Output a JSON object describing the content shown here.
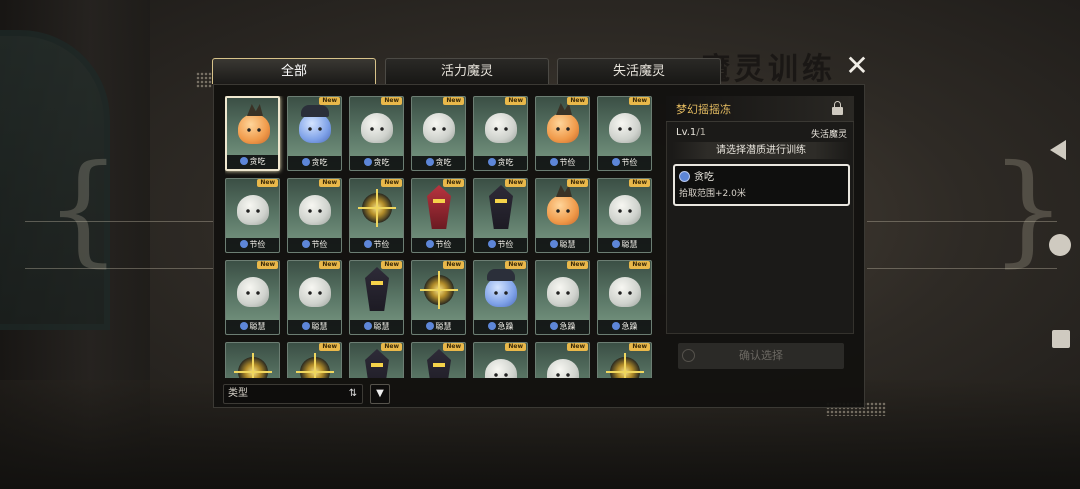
{
  "background": {
    "title": "魔灵训练"
  },
  "tabs": [
    {
      "label": "全部",
      "active": true
    },
    {
      "label": "活力魔灵",
      "active": false
    },
    {
      "label": "失活魔灵",
      "active": false
    }
  ],
  "grid": {
    "new_badge": "New",
    "cards": [
      {
        "trait": "贪吃",
        "creature": "orange",
        "new": false,
        "selected": true
      },
      {
        "trait": "贪吃",
        "creature": "blue",
        "new": true
      },
      {
        "trait": "贪吃",
        "creature": "white",
        "new": true
      },
      {
        "trait": "贪吃",
        "creature": "white",
        "new": true
      },
      {
        "trait": "贪吃",
        "creature": "white",
        "new": true
      },
      {
        "trait": "节俭",
        "creature": "orange",
        "new": true
      },
      {
        "trait": "节俭",
        "creature": "white",
        "new": true
      },
      {
        "trait": "节俭",
        "creature": "white",
        "new": true
      },
      {
        "trait": "节俭",
        "creature": "white",
        "new": true
      },
      {
        "trait": "节俭",
        "creature": "orb",
        "new": true
      },
      {
        "trait": "节俭",
        "creature": "red-knight",
        "new": true
      },
      {
        "trait": "节俭",
        "creature": "knight",
        "new": true
      },
      {
        "trait": "聪慧",
        "creature": "orange",
        "new": true
      },
      {
        "trait": "聪慧",
        "creature": "white",
        "new": true
      },
      {
        "trait": "聪慧",
        "creature": "white",
        "new": true
      },
      {
        "trait": "聪慧",
        "creature": "white",
        "new": true
      },
      {
        "trait": "聪慧",
        "creature": "knight",
        "new": true
      },
      {
        "trait": "聪慧",
        "creature": "orb",
        "new": true
      },
      {
        "trait": "急躁",
        "creature": "blue",
        "new": true
      },
      {
        "trait": "急躁",
        "creature": "white",
        "new": true
      },
      {
        "trait": "急躁",
        "creature": "white",
        "new": true
      },
      {
        "trait": "",
        "creature": "orb",
        "new": false
      },
      {
        "trait": "",
        "creature": "orb",
        "new": true
      },
      {
        "trait": "",
        "creature": "knight",
        "new": true
      },
      {
        "trait": "",
        "creature": "knight",
        "new": true
      },
      {
        "trait": "",
        "creature": "white",
        "new": true
      },
      {
        "trait": "",
        "creature": "white",
        "new": true
      },
      {
        "trait": "",
        "creature": "orb",
        "new": true
      }
    ]
  },
  "filter": {
    "type_label": "类型",
    "sort_icon": "sort-icon",
    "filter_icon": "filter-icon"
  },
  "detail": {
    "name": "梦幻摇摇冻",
    "level": "Lv.1",
    "level_max": "/1",
    "type": "失活魔灵",
    "instruction": "请选择潜质进行训练",
    "trait": {
      "name": "贪吃",
      "desc": "拾取范围+2.0米"
    },
    "confirm_label": "确认选择"
  },
  "colors": {
    "accent_gold": "#e7be62",
    "new_badge": "#e9b84a",
    "trait_icon": "#5d86d8"
  }
}
